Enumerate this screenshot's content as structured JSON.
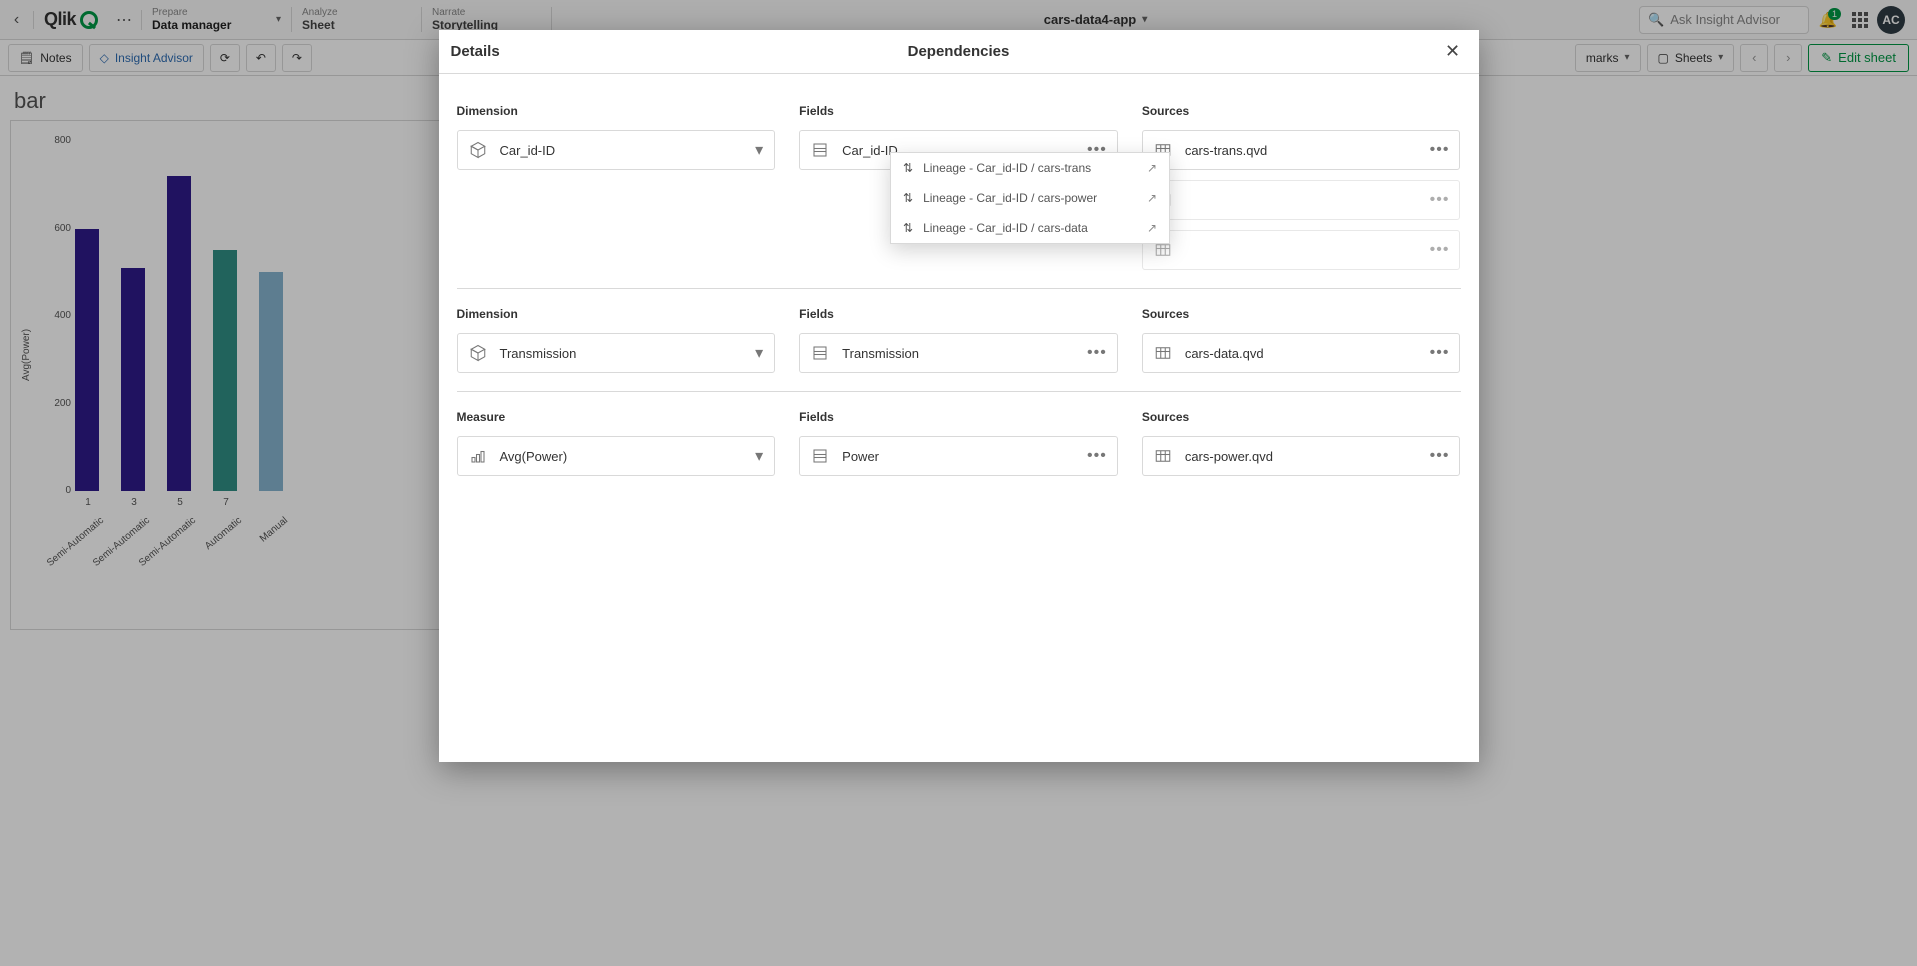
{
  "topbar": {
    "logo_text": "Qlik",
    "phase_prepare": {
      "line1": "Prepare",
      "line2": "Data manager"
    },
    "phase_analyze": {
      "line1": "Analyze",
      "line2": "Sheet"
    },
    "phase_narrate": {
      "line1": "Narrate",
      "line2": "Storytelling"
    },
    "app_name": "cars-data4-app",
    "search_placeholder": "Ask Insight Advisor",
    "notif_count": "1",
    "avatar": "AC"
  },
  "toolbar2": {
    "notes": "Notes",
    "insight": "Insight Advisor",
    "bookmarks": "marks",
    "sheets": "Sheets",
    "edit": "Edit sheet"
  },
  "chart": {
    "title": "bar",
    "ylabel": "Avg(Power)",
    "yticks": [
      "0",
      "200",
      "400",
      "600",
      "800"
    ],
    "chart_data": {
      "type": "bar",
      "ylim": [
        0,
        800
      ],
      "series": [
        {
          "x": "1",
          "cat": "Semi-Automatic",
          "v": 600,
          "color": "blue"
        },
        {
          "x": "3",
          "cat": "Semi-Automatic",
          "v": 510,
          "color": "blue"
        },
        {
          "x": "5",
          "cat": "Semi-Automatic",
          "v": 720,
          "color": "blue"
        },
        {
          "x": "7",
          "cat": "Automatic",
          "v": 550,
          "color": "teal"
        },
        {
          "x": "",
          "cat": "Manual",
          "v": 500,
          "color": "lt"
        }
      ]
    }
  },
  "dialog": {
    "title_left": "Details",
    "title_center": "Dependencies",
    "rows": [
      {
        "left_label": "Dimension",
        "left_item": "Car_id-ID",
        "field_label": "Fields",
        "field_item": "Car_id-ID",
        "source_label": "Sources",
        "sources": [
          "cars-trans.qvd"
        ]
      },
      {
        "left_label": "Dimension",
        "left_item": "Transmission",
        "field_label": "Fields",
        "field_item": "Transmission",
        "source_label": "Sources",
        "sources": [
          "cars-data.qvd"
        ]
      },
      {
        "left_label": "Measure",
        "left_item": "Avg(Power)",
        "field_label": "Fields",
        "field_item": "Power",
        "source_label": "Sources",
        "sources": [
          "cars-power.qvd"
        ]
      }
    ],
    "popover": [
      "Lineage - Car_id-ID / cars-trans",
      "Lineage - Car_id-ID / cars-power",
      "Lineage - Car_id-ID / cars-data"
    ]
  }
}
